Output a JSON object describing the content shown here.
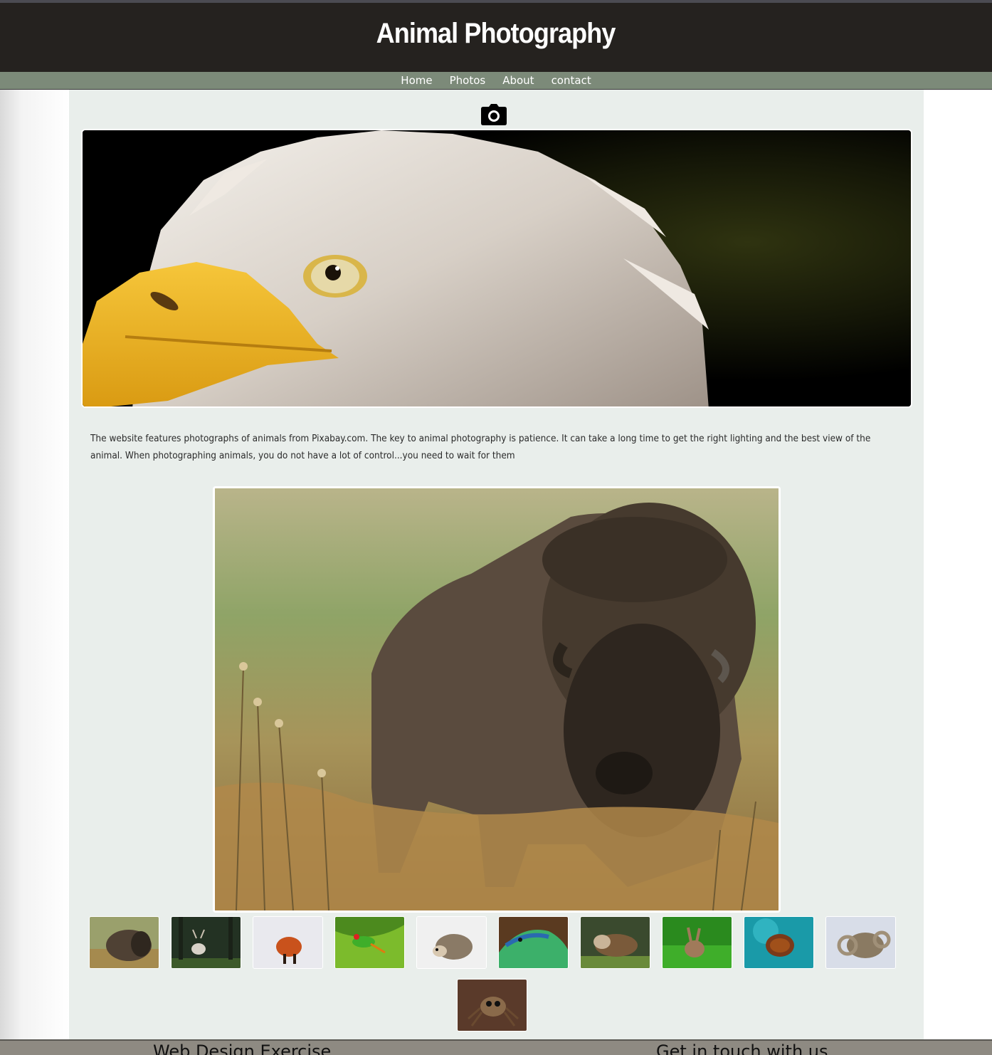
{
  "header": {
    "title": "Animal Photography"
  },
  "nav": {
    "items": [
      "Home",
      "Photos",
      "About",
      "contact"
    ]
  },
  "intro_text": "The website features photographs of animals from Pixabay.com. The key to animal photography is patience. It can take a long time to get the right lighting and the best view of the animal. When photographing animals, you do not have a lot of control...you need to wait for them",
  "images": {
    "hero": "eagle-photo",
    "feature": "bison-photo",
    "thumbnails": [
      "bison-thumb",
      "deer-thumb",
      "fox-thumb",
      "frog-thumb",
      "hedgehog-thumb",
      "lizard-thumb",
      "otter-thumb",
      "rabbit-thumb",
      "turtle-thumb",
      "ram-thumb",
      "spider-thumb"
    ]
  },
  "footer": {
    "left_heading": "Web Design Exercise",
    "right_heading": "Get in touch with us"
  },
  "colors": {
    "header_bg": "#25221f",
    "nav_bg": "#7c8a79",
    "content_bg": "#e9eeeb",
    "footer_bg": "#8e8a82"
  }
}
